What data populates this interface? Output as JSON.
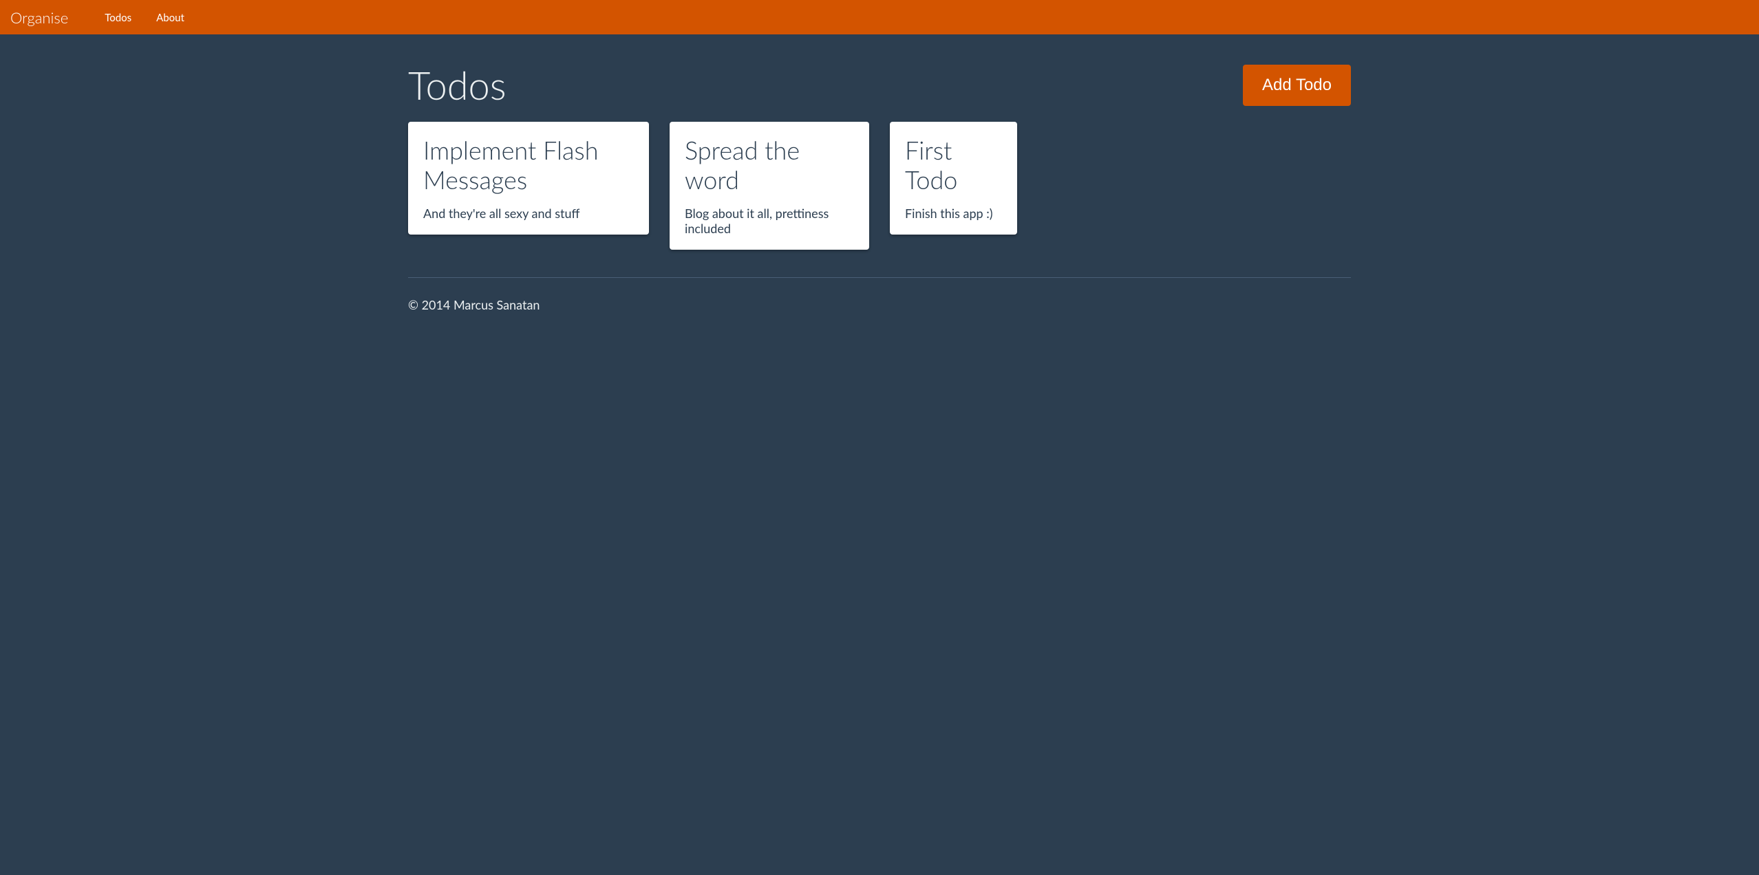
{
  "navbar": {
    "brand": "Organise",
    "links": [
      {
        "label": "Todos"
      },
      {
        "label": "About"
      }
    ]
  },
  "page": {
    "title": "Todos",
    "addButton": "Add Todo"
  },
  "todos": [
    {
      "title": "Implement Flash Messages",
      "description": "And they're all sexy and stuff"
    },
    {
      "title": "Spread the word",
      "description": "Blog about it all, prettiness included"
    },
    {
      "title": "First Todo",
      "description": "Finish this app :)"
    }
  ],
  "footer": {
    "copyright": "© 2014 Marcus Sanatan"
  }
}
